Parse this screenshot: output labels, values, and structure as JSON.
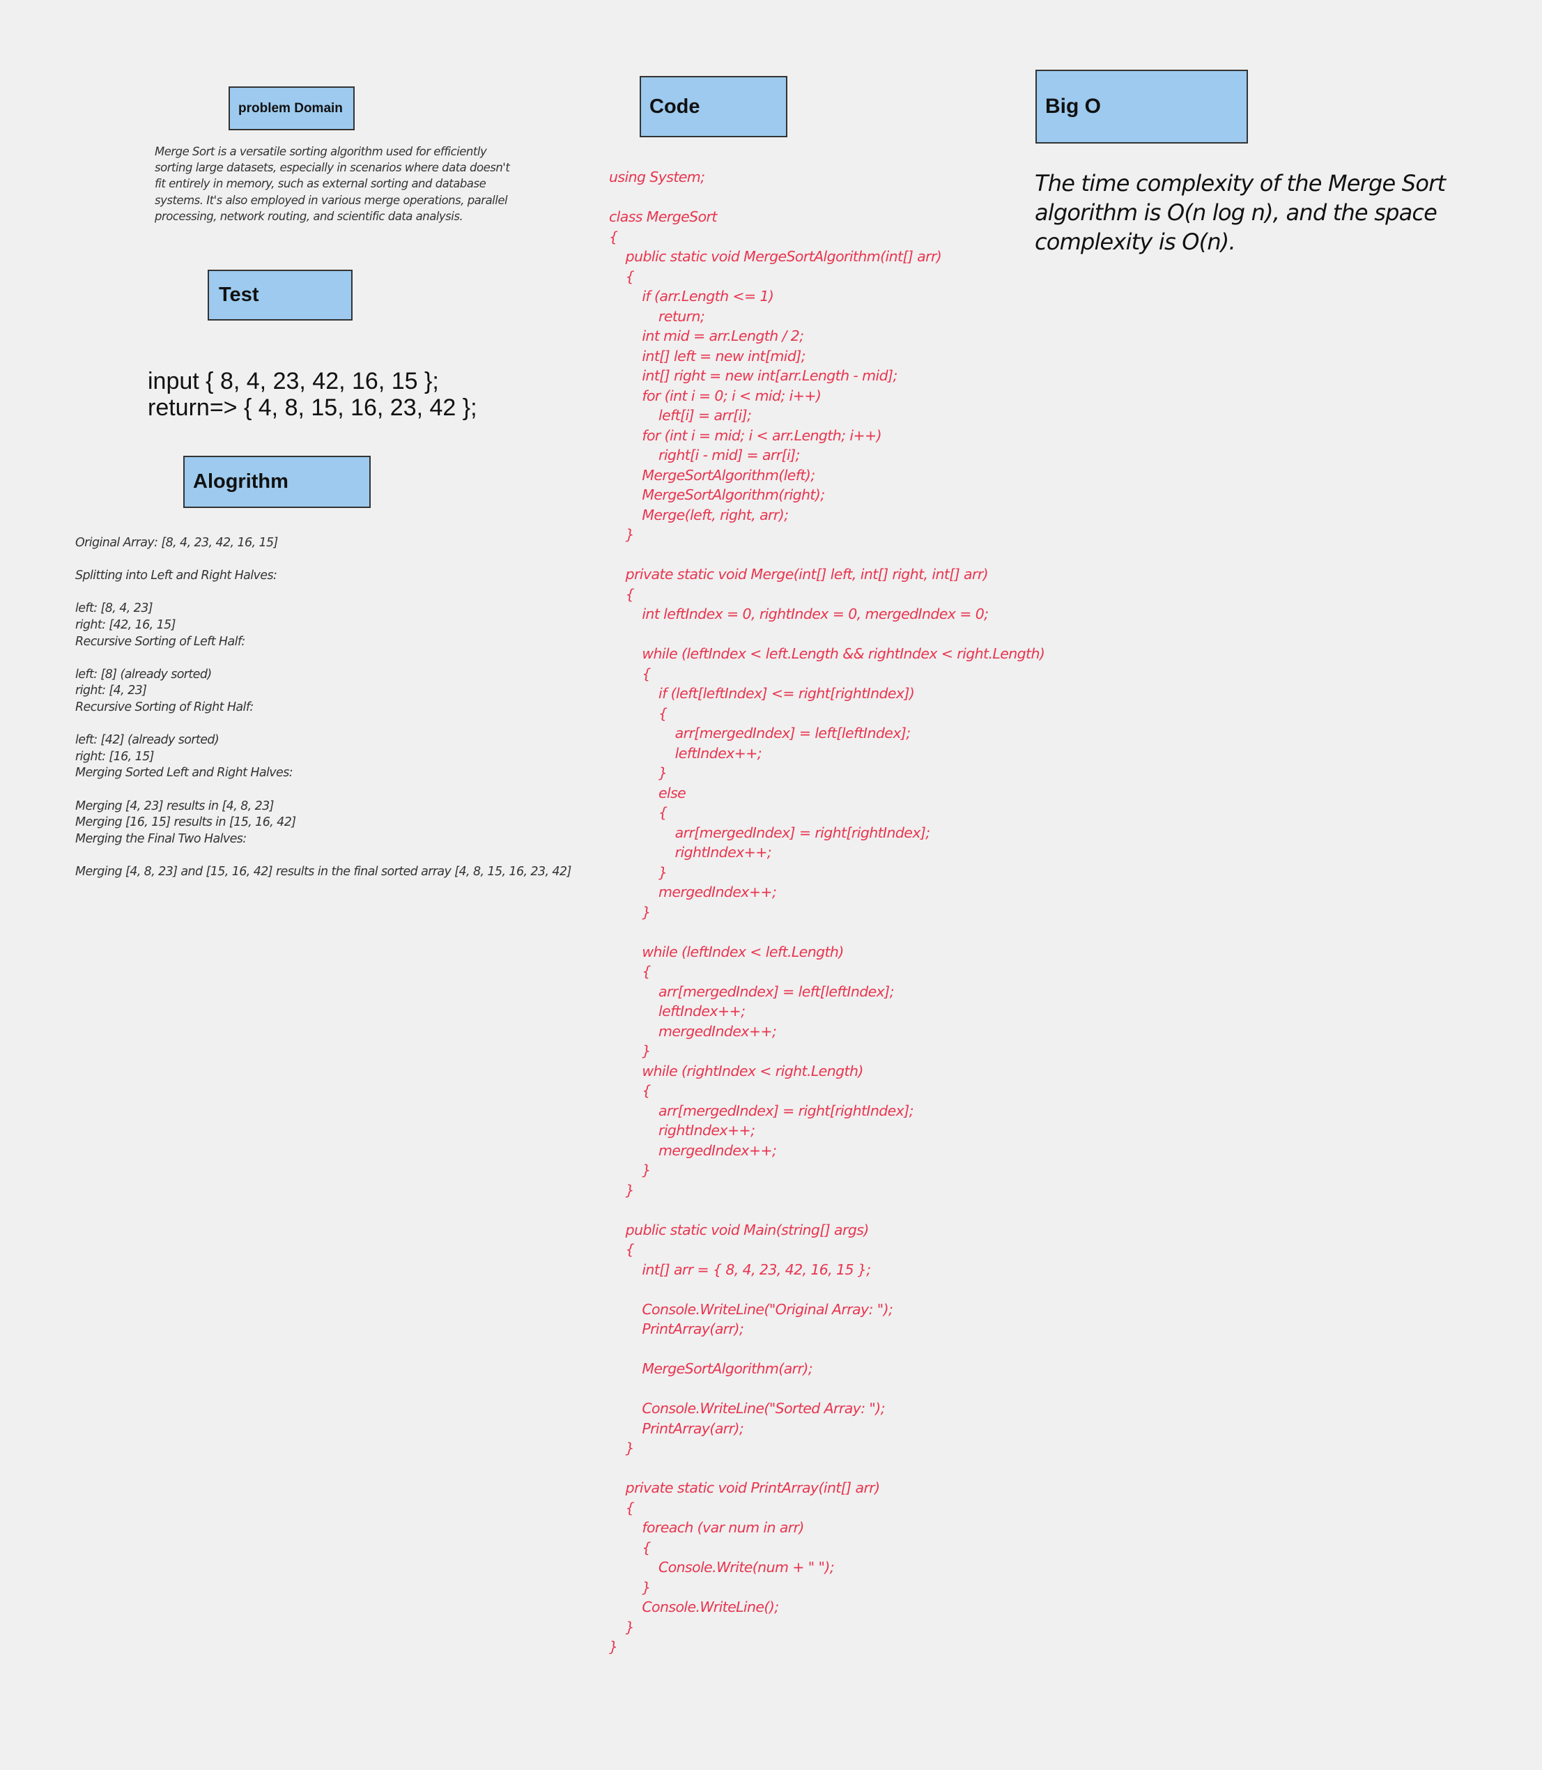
{
  "sections": {
    "problem_domain": {
      "title": "problem Domain",
      "body": "Merge Sort is a versatile sorting algorithm used for efficiently sorting large datasets, especially in scenarios where data doesn't fit entirely in memory, such as external sorting and database systems. It's also employed in various merge operations, parallel processing, network routing, and scientific data analysis."
    },
    "test": {
      "title": "Test",
      "body": "input { 8, 4, 23, 42, 16, 15 };\nreturn=> { 4, 8, 15, 16, 23, 42 };"
    },
    "algorithm": {
      "title": "Alogrithm",
      "body": "Original Array: [8, 4, 23, 42, 16, 15]\n\nSplitting into Left and Right Halves:\n\nleft: [8, 4, 23]\nright: [42, 16, 15]\nRecursive Sorting of Left Half:\n\nleft: [8] (already sorted)\nright: [4, 23]\nRecursive Sorting of Right Half:\n\nleft: [42] (already sorted)\nright: [16, 15]\nMerging Sorted Left and Right Halves:\n\nMerging [4, 23] results in [4, 8, 23]\nMerging [16, 15] results in [15, 16, 42]\nMerging the Final Two Halves:\n\nMerging [4, 8, 23] and [15, 16, 42] results in the final sorted array [4, 8, 15, 16, 23, 42]"
    },
    "code": {
      "title": "Code",
      "body": "using System;\n\nclass MergeSort\n{\n    public static void MergeSortAlgorithm(int[] arr)\n    {\n        if (arr.Length <= 1)\n            return;\n        int mid = arr.Length / 2;\n        int[] left = new int[mid];\n        int[] right = new int[arr.Length - mid];\n        for (int i = 0; i < mid; i++)\n            left[i] = arr[i];\n        for (int i = mid; i < arr.Length; i++)\n            right[i - mid] = arr[i];\n        MergeSortAlgorithm(left);\n        MergeSortAlgorithm(right);\n        Merge(left, right, arr);\n    }\n\n    private static void Merge(int[] left, int[] right, int[] arr)\n    {\n        int leftIndex = 0, rightIndex = 0, mergedIndex = 0;\n\n        while (leftIndex < left.Length && rightIndex < right.Length)\n        {\n            if (left[leftIndex] <= right[rightIndex])\n            {\n                arr[mergedIndex] = left[leftIndex];\n                leftIndex++;\n            }\n            else\n            {\n                arr[mergedIndex] = right[rightIndex];\n                rightIndex++;\n            }\n            mergedIndex++;\n        }\n\n        while (leftIndex < left.Length)\n        {\n            arr[mergedIndex] = left[leftIndex];\n            leftIndex++;\n            mergedIndex++;\n        }\n        while (rightIndex < right.Length)\n        {\n            arr[mergedIndex] = right[rightIndex];\n            rightIndex++;\n            mergedIndex++;\n        }\n    }\n\n    public static void Main(string[] args)\n    {\n        int[] arr = { 8, 4, 23, 42, 16, 15 };\n\n        Console.WriteLine(\"Original Array: \");\n        PrintArray(arr);\n\n        MergeSortAlgorithm(arr);\n\n        Console.WriteLine(\"Sorted Array: \");\n        PrintArray(arr);\n    }\n\n    private static void PrintArray(int[] arr)\n    {\n        foreach (var num in arr)\n        {\n            Console.Write(num + \" \");\n        }\n        Console.WriteLine();\n    }\n}"
    },
    "big_o": {
      "title": "Big O",
      "body": "The time complexity of the Merge Sort algorithm is O(n log n), and the space complexity is O(n)."
    }
  },
  "colors": {
    "background": "#f0f0f0",
    "box_fill": "#9dcaee",
    "box_border": "#333333",
    "code_text": "#e8354f"
  }
}
